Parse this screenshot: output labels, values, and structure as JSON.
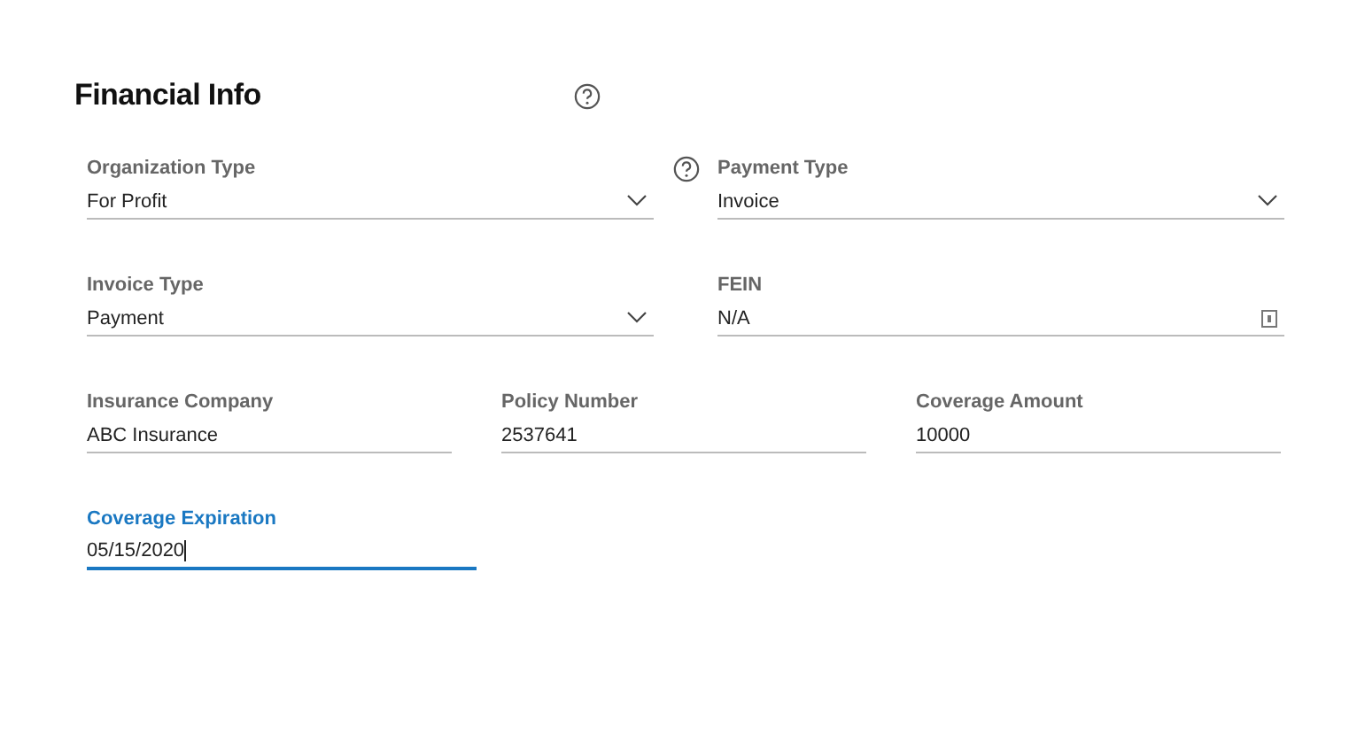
{
  "section": {
    "title": "Financial Info",
    "help": true
  },
  "rows": [
    {
      "kind": "pair",
      "fields": [
        {
          "label": "Organization Type",
          "value": "For Profit",
          "kind": "select",
          "help": true,
          "focused": false
        },
        {
          "label": "Payment Type",
          "value": "Invoice",
          "kind": "select",
          "help": false,
          "focused": false
        }
      ]
    },
    {
      "kind": "pair",
      "fields": [
        {
          "label": "Invoice Type",
          "value": "Payment",
          "kind": "select",
          "help": false,
          "focused": false
        },
        {
          "label": "FEIN",
          "value": "N/A",
          "kind": "masked",
          "help": false,
          "focused": false
        }
      ]
    },
    {
      "kind": "triple",
      "fields": [
        {
          "label": "Insurance Company",
          "value": "ABC Insurance",
          "kind": "text",
          "help": false,
          "focused": false
        },
        {
          "label": "Policy Number",
          "value": "2537641",
          "kind": "text",
          "help": false,
          "focused": false
        },
        {
          "label": "Coverage Amount",
          "value": "10000",
          "kind": "text",
          "help": false,
          "focused": false
        }
      ]
    },
    {
      "kind": "single",
      "fields": [
        {
          "label": "Coverage Expiration",
          "value": "05/15/2020",
          "kind": "text",
          "help": false,
          "focused": true
        }
      ]
    }
  ]
}
